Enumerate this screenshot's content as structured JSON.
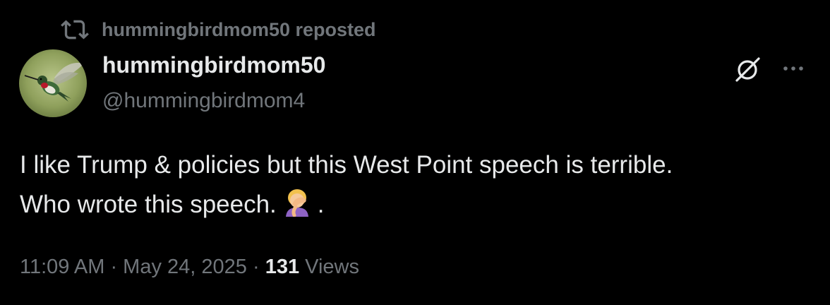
{
  "repost_banner": {
    "text": "hummingbirdmom50 reposted",
    "icon": "repost-icon"
  },
  "author": {
    "display_name": "hummingbirdmom50",
    "handle": "@hummingbirdmom4",
    "avatar": "hummingbird-avatar"
  },
  "header_actions": {
    "grok_icon": "grok-icon",
    "more_icon": "more-icon"
  },
  "tweet": {
    "line1": "I like Trump & policies but this West Point speech is terrible.",
    "line2_text": "Who wrote this speech.",
    "line2_end": ".",
    "emoji": "facepalm-emoji"
  },
  "meta": {
    "time": "11:09 AM",
    "sep1": " · ",
    "date": "May 24, 2025",
    "sep2": " · ",
    "views_count": "131",
    "views_label": " Views"
  },
  "colors": {
    "background": "#000000",
    "primary_text": "#e7e9ea",
    "secondary_text": "#71767b"
  }
}
